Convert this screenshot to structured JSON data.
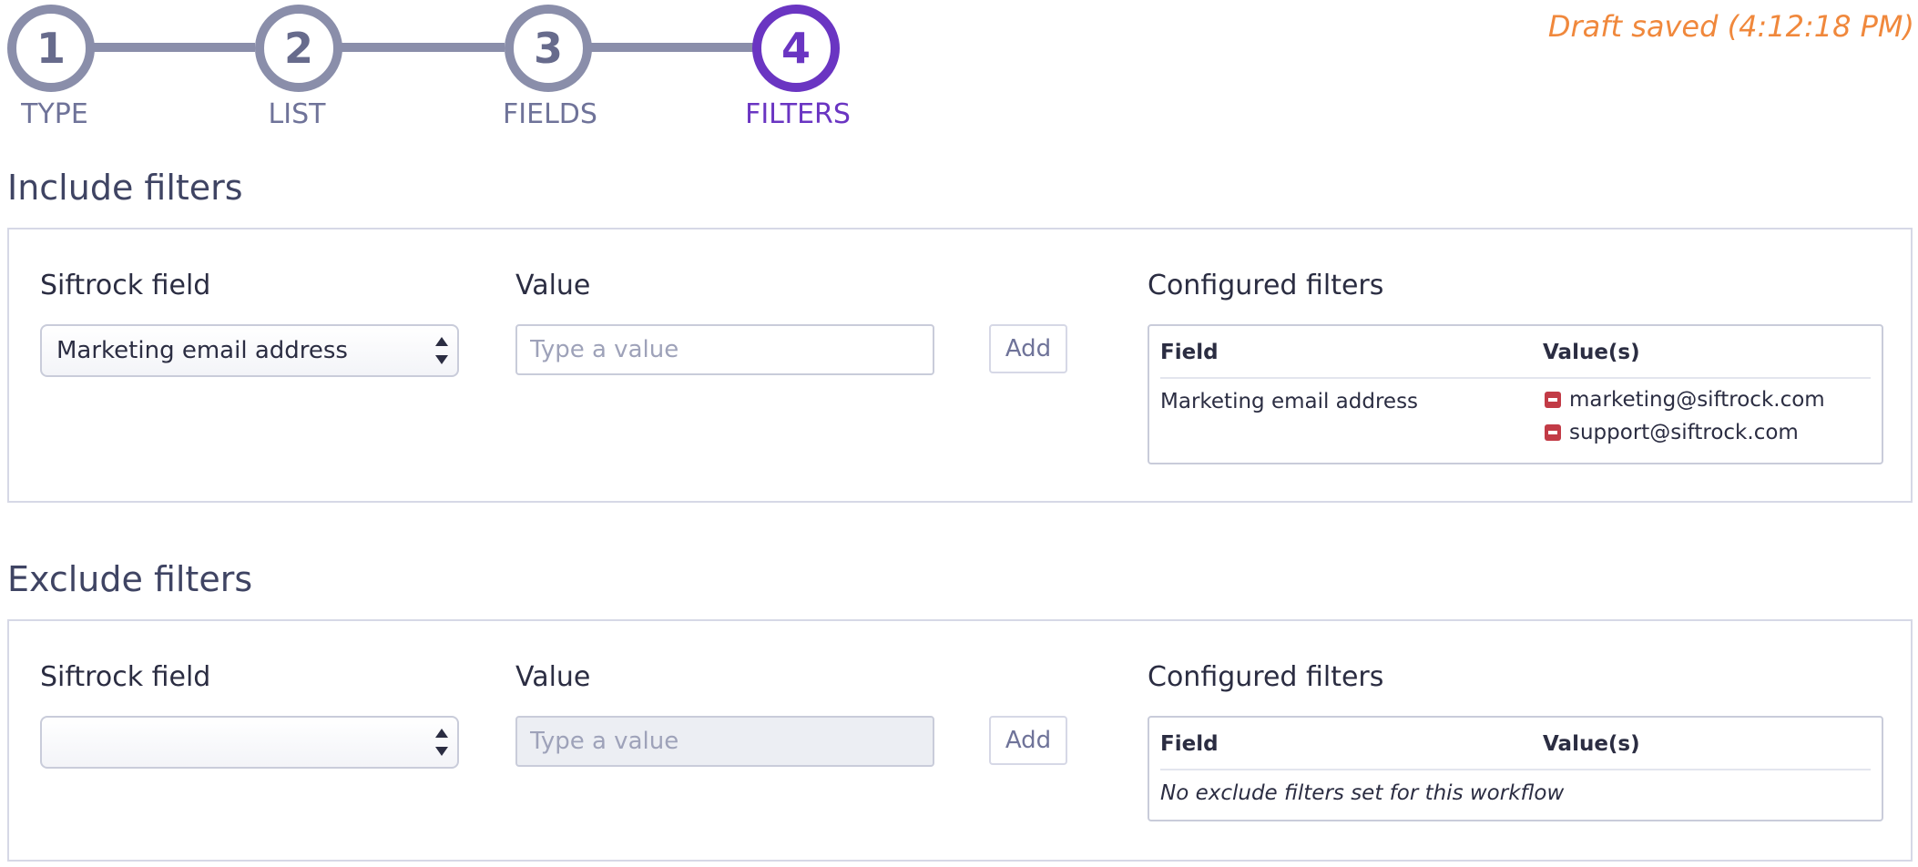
{
  "stepper": {
    "steps": [
      {
        "number": "1",
        "label": "TYPE",
        "active": false
      },
      {
        "number": "2",
        "label": "LIST",
        "active": false
      },
      {
        "number": "3",
        "label": "FIELDS",
        "active": false
      },
      {
        "number": "4",
        "label": "FILTERS",
        "active": true
      }
    ]
  },
  "draft_status": "Draft saved (4:12:18 PM)",
  "include": {
    "title": "Include filters",
    "field_label": "Siftrock field",
    "selected_field": "Marketing email address",
    "value_label": "Value",
    "value_placeholder": "Type a value",
    "add_label": "Add",
    "configured_label": "Configured filters",
    "table": {
      "col_field": "Field",
      "col_values": "Value(s)",
      "rows": [
        {
          "field": "Marketing email address",
          "values": [
            "marketing@siftrock.com",
            "support@siftrock.com"
          ]
        }
      ]
    }
  },
  "exclude": {
    "title": "Exclude filters",
    "field_label": "Siftrock field",
    "selected_field": "",
    "value_label": "Value",
    "value_placeholder": "Type a value",
    "add_label": "Add",
    "configured_label": "Configured filters",
    "table": {
      "col_field": "Field",
      "col_values": "Value(s)",
      "empty_message": "No exclude filters set for this workflow"
    }
  },
  "colors": {
    "active_step": "#6a35c2",
    "inactive_step": "#8a8eaa",
    "draft_status": "#f0883c",
    "remove_icon": "#c23b46"
  }
}
